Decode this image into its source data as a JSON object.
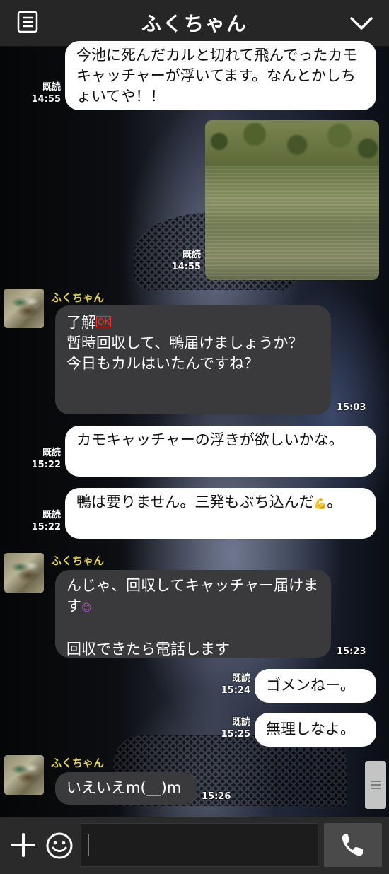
{
  "header": {
    "title": "ふくちゃん",
    "menu_icon": "list-icon",
    "collapse_icon": "chevron-down-icon"
  },
  "messages": [
    {
      "side": "out",
      "text": "今池に死んだカルと切れて飛んでったカモキャッチャーが浮いてます。なんとかしちょいてや！！",
      "read": "既読",
      "time": "14:55"
    },
    {
      "side": "out",
      "type": "photo",
      "read": "既読",
      "time": "14:55"
    },
    {
      "side": "in",
      "sender": "ふくちゃん",
      "text_a": "了解",
      "badge": "OK",
      "text_b": "\n暫時回収して、鴨届けましょうか？\n今日もカルはいたんですね？",
      "time": "15:03"
    },
    {
      "side": "out",
      "text": "カモキャッチャーの浮きが欲しいかな。",
      "read": "既読",
      "time": "15:22"
    },
    {
      "side": "out",
      "text_a": "鴨は要りません。三発もぶち込んだ",
      "emoji": "💪",
      "text_b": "。",
      "read": "既読",
      "time": "15:22"
    },
    {
      "side": "in",
      "sender": "ふくちゃん",
      "text_a": "んじゃ、回収してキャッチャー届けます",
      "emoji": "😊",
      "text_b": "\n\n回収できたら電話します",
      "time": "15:23"
    },
    {
      "side": "out",
      "text": "ゴメンねー。",
      "read": "既読",
      "time": "15:24"
    },
    {
      "side": "out",
      "text": "無理しなよ。",
      "read": "既読",
      "time": "15:25"
    },
    {
      "side": "in",
      "sender": "ふくちゃん",
      "text": "いえいえm(__)m",
      "time": "15:26"
    }
  ],
  "input": {
    "placeholder": "",
    "value": ""
  },
  "toolbar": {
    "plus_icon": "plus-icon",
    "emoji_icon": "smiley-icon",
    "call_icon": "phone-icon"
  },
  "colors": {
    "header_bg": "#262626",
    "out_bubble": "#ffffff",
    "in_bubble": "#3a3a3c",
    "sender_name": "#e6d84a"
  }
}
